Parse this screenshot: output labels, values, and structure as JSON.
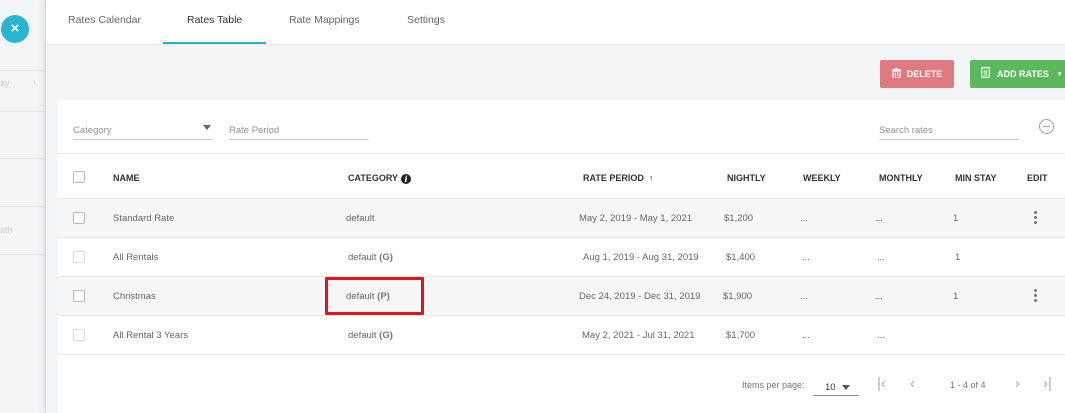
{
  "sidebar": {
    "close_icon": "×",
    "fragments": [
      "ay",
      "ath"
    ],
    "chevron": "›"
  },
  "tabs": [
    {
      "label": "Rates Calendar"
    },
    {
      "label": "Rates Table"
    },
    {
      "label": "Rate Mappings"
    },
    {
      "label": "Settings"
    }
  ],
  "active_tab": "Rates Table",
  "toolbar": {
    "delete_label": "DELETE",
    "add_label": "ADD RATES"
  },
  "filters": {
    "category_placeholder": "Category",
    "rate_period_placeholder": "Rate Period",
    "search_placeholder": "Search rates"
  },
  "table": {
    "headers": {
      "name": "NAME",
      "category": "CATEGORY",
      "rate_period": "RATE PERIOD",
      "nightly": "NIGHTLY",
      "weekly": "WEEKLY",
      "monthly": "MONTHLY",
      "min_stay": "MIN STAY",
      "edit": "EDIT"
    },
    "rows": [
      {
        "name": "Standard Rate",
        "category": "default",
        "tag": "",
        "period": "May 2, 2019 - May 1, 2021",
        "nightly": "$1,200",
        "weekly": "...",
        "monthly": "...",
        "min_stay": "1"
      },
      {
        "name": "All Rentals",
        "category": "default",
        "tag": "(G)",
        "period": "Aug 1, 2019 - Aug 31, 2019",
        "nightly": "$1,400",
        "weekly": "...",
        "monthly": "...",
        "min_stay": "1"
      },
      {
        "name": "Christmas",
        "category": "default",
        "tag": "(P)",
        "period": "Dec 24, 2019 - Dec 31, 2019",
        "nightly": "$1,900",
        "weekly": "...",
        "monthly": "...",
        "min_stay": "1"
      },
      {
        "name": "All Rental 3 Years",
        "category": "default",
        "tag": "(G)",
        "period": "May 2, 2021 - Jul 31, 2021",
        "nightly": "$1,700",
        "weekly": "...",
        "monthly": "...",
        "min_stay": ""
      }
    ]
  },
  "pagination": {
    "items_per_page_label": "Items per page:",
    "items_per_page": "10",
    "range": "1 - 4 of 4",
    "first_icon": "|‹",
    "prev_icon": "‹",
    "next_icon": "›",
    "last_icon": "›|"
  },
  "colors": {
    "accent": "#23b3c9",
    "delete": "#df7b80",
    "add": "#5cb85c",
    "highlight": "#e0141b"
  }
}
